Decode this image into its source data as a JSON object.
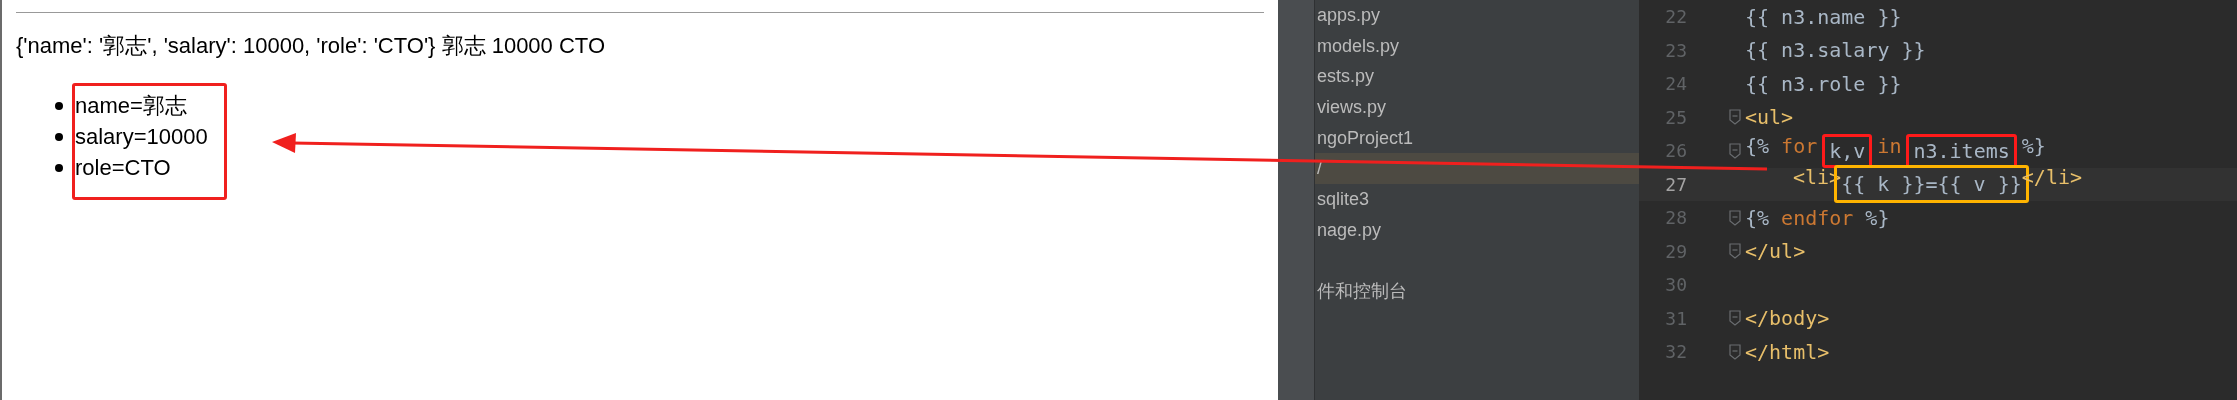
{
  "browser": {
    "summary_line": "{'name': '郭志', 'salary': 10000, 'role': 'CTO'} 郭志 10000 CTO",
    "list_items": [
      "name=郭志",
      "salary=10000",
      "role=CTO"
    ]
  },
  "project_tree": {
    "items": [
      {
        "label": "apps.py",
        "selected": false
      },
      {
        "label": "models.py",
        "selected": false
      },
      {
        "label": "ests.py",
        "selected": false
      },
      {
        "label": "views.py",
        "selected": false
      },
      {
        "label": "ngoProject1",
        "selected": false
      },
      {
        "label": "/",
        "selected": true
      },
      {
        "label": "sqlite3",
        "selected": false
      },
      {
        "label": "nage.py",
        "selected": false
      },
      {
        "label": "件和控制台",
        "selected": false
      }
    ]
  },
  "editor": {
    "lines": [
      {
        "number": "22",
        "current": false,
        "fold_marker": false,
        "indented": false,
        "tokens": [
          {
            "text": "{{ n3.name }}",
            "kind": "plain"
          }
        ]
      },
      {
        "number": "23",
        "current": false,
        "fold_marker": false,
        "indented": false,
        "tokens": [
          {
            "text": "{{ n3.salary }}",
            "kind": "plain"
          }
        ]
      },
      {
        "number": "24",
        "current": false,
        "fold_marker": false,
        "indented": false,
        "tokens": [
          {
            "text": "{{ n3.role }}",
            "kind": "plain"
          }
        ]
      },
      {
        "number": "25",
        "current": false,
        "fold_marker": true,
        "indented": false,
        "tokens": [
          {
            "text": "<ul>",
            "kind": "tag"
          }
        ]
      },
      {
        "number": "26",
        "current": false,
        "fold_marker": true,
        "indented": false,
        "tokens": [
          {
            "text": "{%",
            "kind": "plain"
          },
          {
            "text": "for",
            "kind": "keyword"
          },
          {
            "text": "k,v",
            "kind": "plain",
            "color": "#ff1a1a"
          },
          {
            "text": "in",
            "kind": "keyword"
          },
          {
            "text": "n3.items",
            "kind": "plain",
            "color": "#ff1a1a"
          },
          {
            "text": "%}",
            "kind": "plain"
          }
        ]
      },
      {
        "number": "27",
        "current": true,
        "fold_marker": false,
        "indented": true,
        "tokens": [
          {
            "text": "<li>",
            "kind": "tag"
          },
          {
            "text": "{{ k }}={{ v }}",
            "kind": "plain",
            "color": "#ffb400"
          },
          {
            "text": "</li>",
            "kind": "tag"
          }
        ]
      },
      {
        "number": "28",
        "current": false,
        "fold_marker": true,
        "indented": false,
        "tokens": [
          {
            "text": "{%",
            "kind": "plain"
          },
          {
            "text": "endfor",
            "kind": "keyword"
          },
          {
            "text": "%}",
            "kind": "plain"
          }
        ]
      },
      {
        "number": "29",
        "current": false,
        "fold_marker": true,
        "indented": false,
        "tokens": [
          {
            "text": "</ul>",
            "kind": "tag"
          }
        ]
      },
      {
        "number": "30",
        "current": false,
        "fold_marker": false,
        "indented": false
      },
      {
        "number": "31",
        "current": false,
        "fold_marker": true,
        "indented": false,
        "tokens": [
          {
            "text": "</body>",
            "kind": "tag"
          }
        ]
      },
      {
        "number": "32",
        "current": false,
        "fold_marker": true,
        "indented": false,
        "tokens": [
          {
            "text": "</html>",
            "kind": "tag"
          }
        ]
      }
    ]
  }
}
